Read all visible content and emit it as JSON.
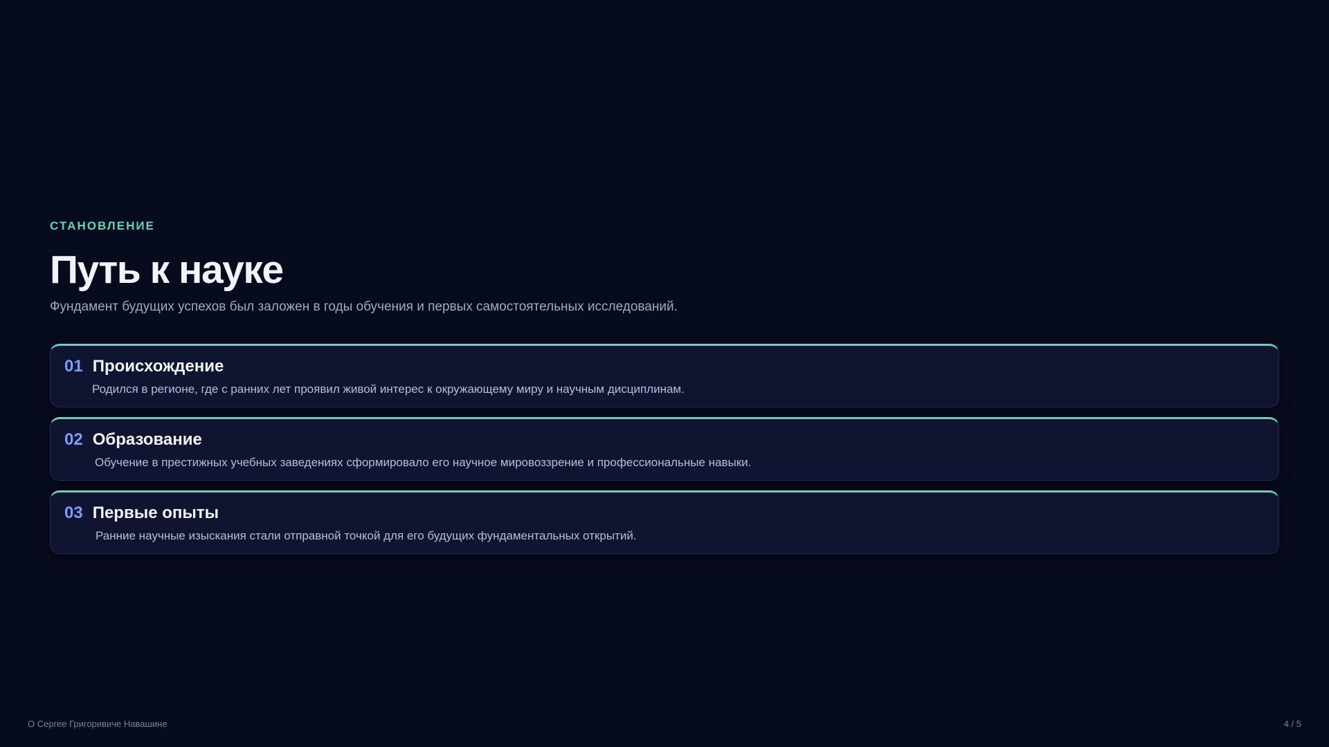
{
  "slide": {
    "eyebrow": "СТАНОВЛЕНИЕ",
    "title": "Путь к науке",
    "subtitle": "Фундамент будущих успехов был заложен в годы обучения и первых самостоятельных исследований."
  },
  "items": [
    {
      "number": "01",
      "title": "Происхождение",
      "text": "Родился в регионе, где с ранних лет проявил живой интерес к окружающему миру и научным дисциплинам."
    },
    {
      "number": "02",
      "title": "Образование",
      "text": "Обучение в престижных учебных заведениях сформировало его научное мировоззрение и профессиональные навыки."
    },
    {
      "number": "03",
      "title": "Первые опыты",
      "text": "Ранние научные изыскания стали отправной точкой для его будущих фундаментальных открытий."
    }
  ],
  "footer": {
    "left": "О Сергее Григоривиче Навашине",
    "page": "4 / 5"
  },
  "colors": {
    "background": "#070b1e",
    "accent": "#5fd6b4",
    "number": "#7f9cf5",
    "card": "#0f1430"
  }
}
